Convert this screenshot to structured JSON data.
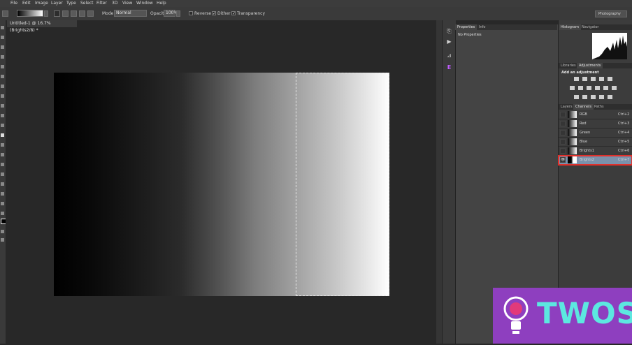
{
  "menu": [
    "File",
    "Edit",
    "Image",
    "Layer",
    "Type",
    "Select",
    "Filter",
    "3D",
    "View",
    "Window",
    "Help"
  ],
  "options": {
    "mode_label": "Mode:",
    "mode_value": "Normal",
    "opacity_label": "Opacity:",
    "opacity_value": "100%",
    "reverse_label": "Reverse",
    "dither_label": "Dither",
    "transparency_label": "Transparency"
  },
  "document": {
    "tab_title": "Untitled-1 @ 16.7% (Brights2/8) *"
  },
  "workspace": "Photography",
  "properties_panel": {
    "tabs": [
      "Properties",
      "Info"
    ],
    "message": "No Properties"
  },
  "histogram_panel": {
    "tabs": [
      "Histogram",
      "Navigator"
    ]
  },
  "adjustments_panel": {
    "tabs": [
      "Libraries",
      "Adjustments"
    ],
    "heading": "Add an adjustment"
  },
  "channels_panel": {
    "tabs": [
      "Layers",
      "Channels",
      "Paths"
    ],
    "channels": [
      {
        "name": "RGB",
        "shortcut": "Ctrl+2",
        "visible": false,
        "selected": false
      },
      {
        "name": "Red",
        "shortcut": "Ctrl+3",
        "visible": false,
        "selected": false
      },
      {
        "name": "Green",
        "shortcut": "Ctrl+4",
        "visible": false,
        "selected": false
      },
      {
        "name": "Blue",
        "shortcut": "Ctrl+5",
        "visible": false,
        "selected": false
      },
      {
        "name": "Brights1",
        "shortcut": "Ctrl+6",
        "visible": false,
        "selected": false
      },
      {
        "name": "Brights2",
        "shortcut": "Ctrl+7",
        "visible": true,
        "selected": true
      }
    ]
  },
  "logo_text": "TWOS",
  "colors": {
    "accent_selected": "#7a91ab",
    "highlight_border": "#e0302b",
    "logo_bg": "#8e3fbf",
    "logo_text": "#5ce8e0"
  }
}
